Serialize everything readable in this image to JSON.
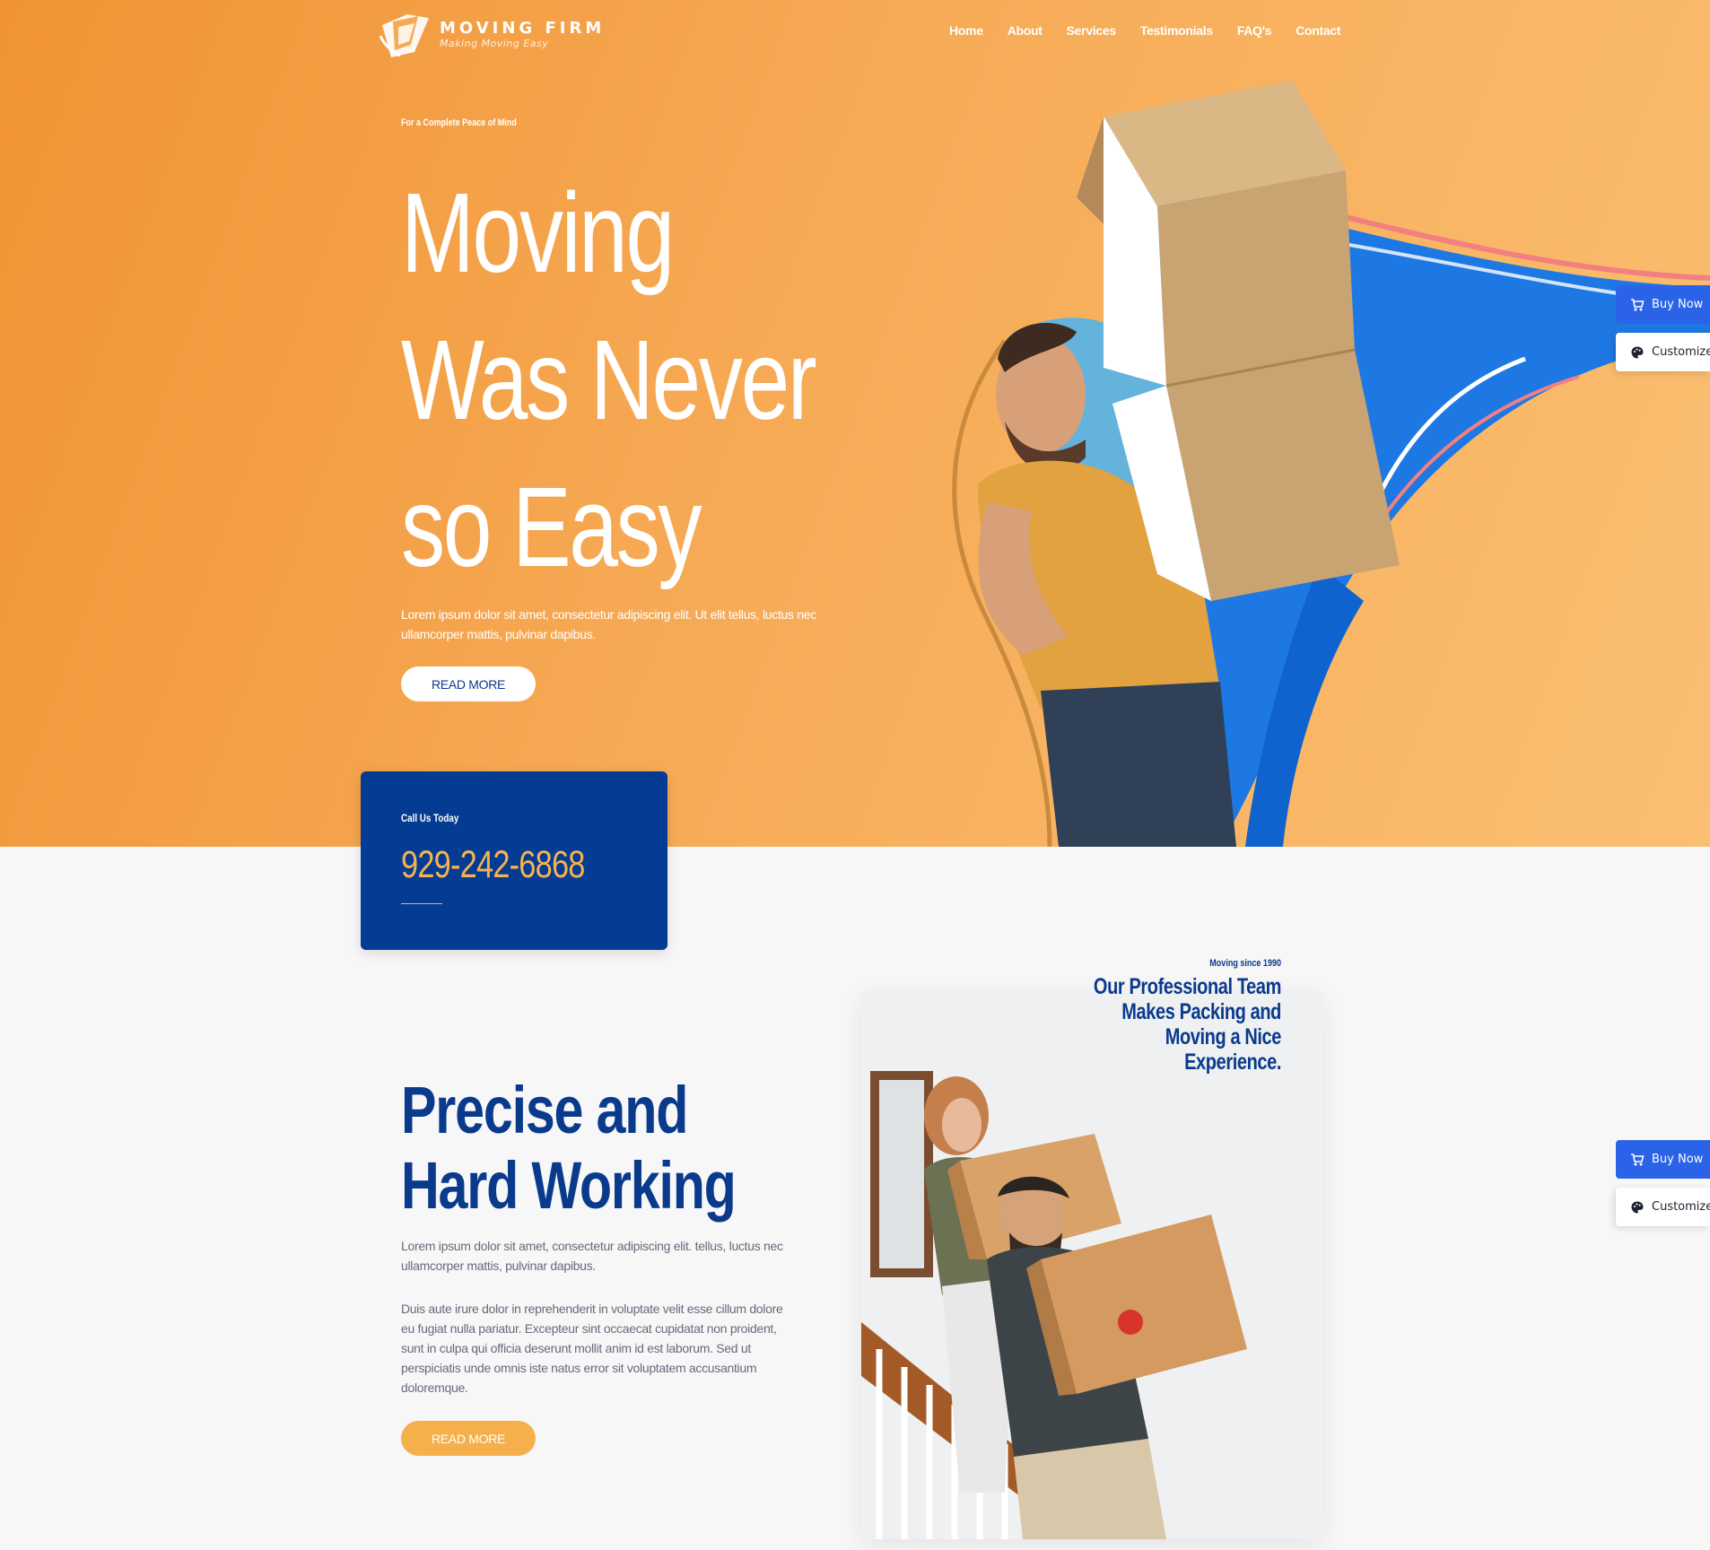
{
  "brand": {
    "name": "MOVING FIRM",
    "tagline": "Making Moving Easy"
  },
  "nav": {
    "items": [
      {
        "label": "Home"
      },
      {
        "label": "About"
      },
      {
        "label": "Services"
      },
      {
        "label": "Testimonials"
      },
      {
        "label": "FAQ's"
      },
      {
        "label": "Contact"
      }
    ]
  },
  "hero": {
    "eyebrow": "For a Complete Peace of Mind",
    "title": "Moving Was Never so Easy",
    "body": "Lorem ipsum dolor sit amet, consectetur adipiscing elit. Ut elit tellus, luctus nec ullamcorper mattis, pulvinar dapibus.",
    "button_label": "READ MORE"
  },
  "call_box": {
    "label": "Call Us Today",
    "phone": "929-242-6868"
  },
  "about": {
    "eyebrow": "Moving since 1990",
    "heading": "Our Professional Team Makes Packing and Moving a Nice Experience.",
    "title": "Precise and Hard Working",
    "paragraph_1": "Lorem ipsum dolor sit amet, consectetur adipiscing elit. tellus, luctus nec ullamcorper mattis, pulvinar dapibus.",
    "paragraph_2": "Duis aute irure dolor in reprehenderit in voluptate velit esse cillum dolore eu fugiat nulla pariatur. Excepteur sint occaecat cupidatat non proident, sunt in culpa qui officia deserunt mollit anim id est laborum. Sed ut perspiciatis unde omnis iste natus error sit voluptatem accusantium doloremque.",
    "button_label": "READ MORE"
  },
  "side_buttons": {
    "buy_now": "Buy Now",
    "customize": "Customize"
  },
  "colors": {
    "hero_orange": "#f6aa55",
    "navy": "#033c92",
    "accent_orange": "#f5b04c",
    "buy_blue": "#2b63e8",
    "background": "#f7f7f8"
  },
  "icons": {
    "logo": "moving-firm-logo-icon",
    "cart": "cart-icon",
    "palette": "palette-icon"
  }
}
